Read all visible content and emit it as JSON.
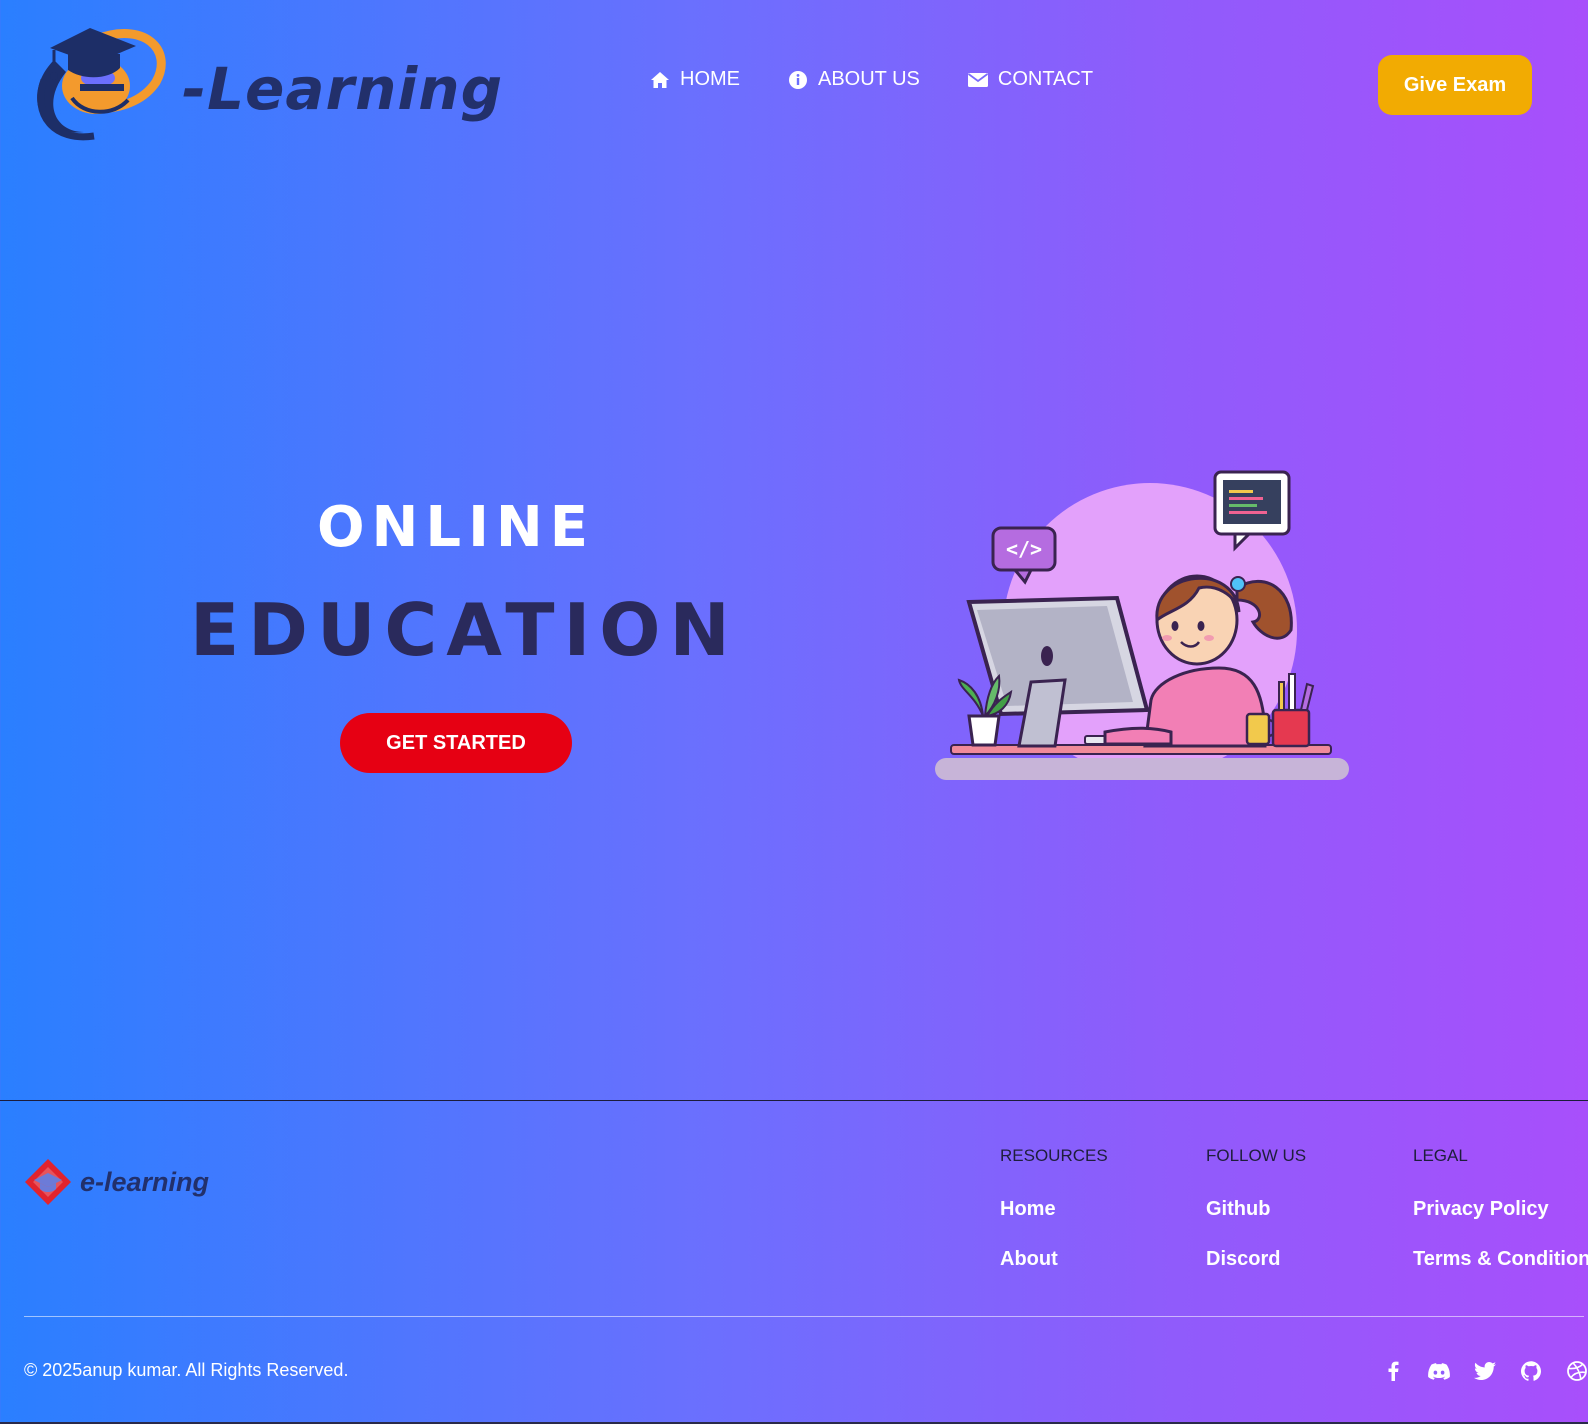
{
  "header": {
    "logo_text": "-Learning",
    "nav": [
      {
        "label": "HOME",
        "icon": "home-icon"
      },
      {
        "label": "ABOUT US",
        "icon": "info-icon"
      },
      {
        "label": "CONTACT",
        "icon": "envelope-icon"
      }
    ],
    "cta_label": "Give Exam"
  },
  "hero": {
    "title_line1": "ONLINE",
    "title_line2": "EDUCATION",
    "button_label": "GET STARTED",
    "illustration": "girl-at-computer-illustration"
  },
  "footer": {
    "logo_text": "e-learning",
    "columns": [
      {
        "title": "RESOURCES",
        "links": [
          "Home",
          "About"
        ]
      },
      {
        "title": "FOLLOW US",
        "links": [
          "Github",
          "Discord"
        ]
      },
      {
        "title": "LEGAL",
        "links": [
          "Privacy Policy",
          "Terms & Conditions"
        ]
      }
    ],
    "copyright": "© 2025anup kumar. All Rights Reserved.",
    "socials": [
      "facebook-icon",
      "discord-icon",
      "twitter-icon",
      "github-icon",
      "dribbble-icon"
    ]
  },
  "colors": {
    "gradient_start": "#2a7fff",
    "gradient_end": "#a84ffb",
    "cta": "#f2ab02",
    "hero_button": "#e60013",
    "logo_navy": "#22306b",
    "logo_orange": "#f39a2d"
  }
}
